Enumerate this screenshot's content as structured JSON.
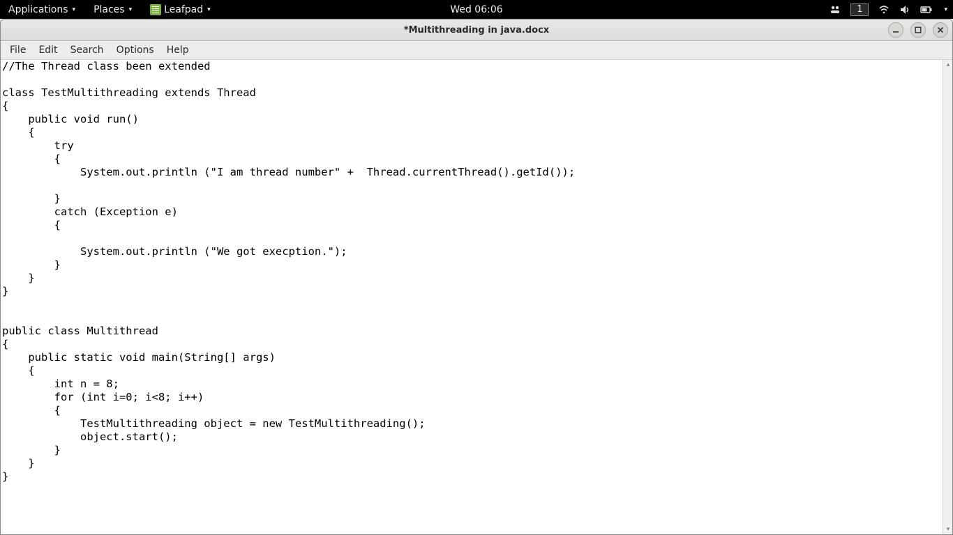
{
  "topbar": {
    "applications": "Applications",
    "places": "Places",
    "app_name": "Leafpad",
    "clock": "Wed 06:06",
    "workspace": "1"
  },
  "window": {
    "title": "*Multithreading in java.docx"
  },
  "menubar": {
    "file": "File",
    "edit": "Edit",
    "search": "Search",
    "options": "Options",
    "help": "Help"
  },
  "editor": {
    "content": "//The Thread class been extended\n\nclass TestMultithreading extends Thread\n{\n    public void run()\n    {\n        try\n        {\n            System.out.println (\"I am thread number\" +  Thread.currentThread().getId());\n\n        }\n        catch (Exception e)\n        {\n\n            System.out.println (\"We got execption.\");\n        }\n    }\n}\n\n\npublic class Multithread\n{\n    public static void main(String[] args)\n    {\n        int n = 8;\n        for (int i=0; i<8; i++)\n        {\n            TestMultithreading object = new TestMultithreading();\n            object.start();\n        }\n    }\n}"
  }
}
